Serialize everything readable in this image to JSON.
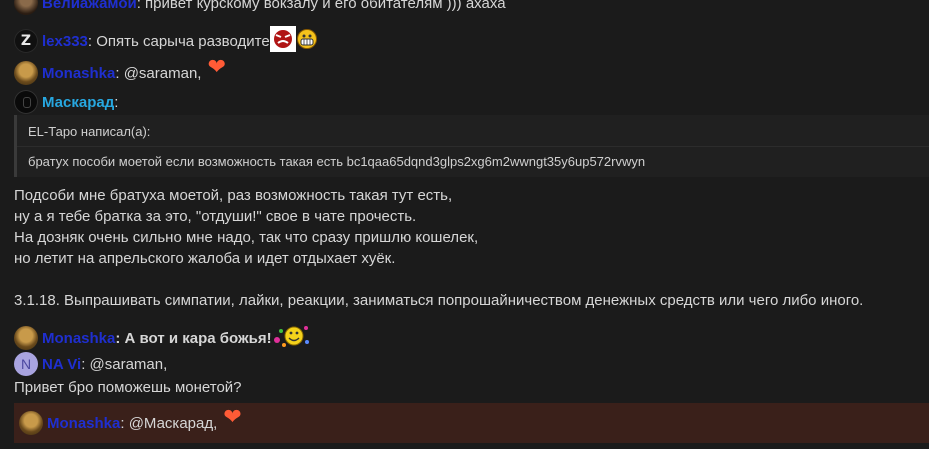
{
  "chat": {
    "messages": [
      {
        "user": "Велиажамой",
        "text": ": привет курскому вокзалу и его обитателям ))) ахаха"
      },
      {
        "user": "lex333",
        "text": ": Опять сарыча разводите"
      },
      {
        "user": "Monashka",
        "text": ": @saraman, "
      },
      {
        "user": "Маскарад",
        "text": ":"
      },
      {
        "user": "Monashka",
        "text": ": А вот и кара божья!"
      },
      {
        "user": "NA Vi",
        "text": ": @saraman, ",
        "line2": "Привет бро поможешь монетой?"
      },
      {
        "user": "Monashka",
        "text": ": @Маскарад, "
      }
    ],
    "quote": {
      "header": "EL-Таро написал(а):",
      "body": "братух пособи моетой если возможность такая есть bc1qaa65dqnd3glps2xg6m2wwngt35y6up572rvwyn"
    },
    "reply_lines": [
      "Подсоби мне братуха моетой, раз возможность такая тут есть,",
      "ну а я тебе братка за это, \"отдуши!\" свое в чате прочесть.",
      "На дозняк очень сильно мне надо, так что сразу пришлю кошелек,",
      "но летит на апрельского жалоба и идет отдыхает хуёк."
    ],
    "rule_text": "3.1.18. Выпрашивать симпатии, лайки, реакции, заниматься попрошайничеством денежных средств или чего либо иного.",
    "avatar_letters": {
      "lex333": "Z",
      "navi": "N"
    },
    "heart_glyph": "❤"
  },
  "colors": {
    "background": "#1b1b1b",
    "username_blue": "#1f2fd0",
    "username_mask": "#27a7e0",
    "highlight_bg": "#3a201a",
    "heart": "#ff5b36"
  }
}
